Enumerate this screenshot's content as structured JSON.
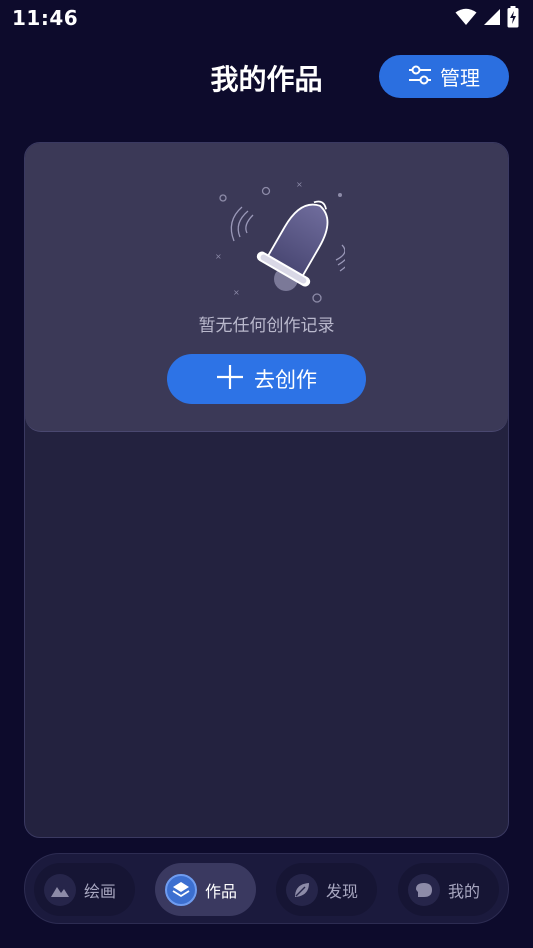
{
  "status_bar": {
    "time": "11:46",
    "icons": [
      "wifi-icon",
      "signal-icon",
      "battery-charging-icon"
    ]
  },
  "header": {
    "title": "我的作品",
    "manage_button": {
      "label": "管理",
      "icon": "sliders-icon"
    }
  },
  "empty_state": {
    "illustration": "bell-icon",
    "message": "暂无任何创作记录",
    "create_button": {
      "label": "去创作",
      "icon": "plus-icon"
    }
  },
  "bottom_nav": {
    "items": [
      {
        "label": "绘画",
        "icon": "mountain-image-icon",
        "active": false
      },
      {
        "label": "作品",
        "icon": "layers-icon",
        "active": true
      },
      {
        "label": "发现",
        "icon": "leaf-icon",
        "active": false
      },
      {
        "label": "我的",
        "icon": "chat-bubble-icon",
        "active": false
      }
    ]
  },
  "colors": {
    "background": "#0d0b2c",
    "accent": "#2b6fe0",
    "panel": "#23223f",
    "card": "#3b3957"
  }
}
